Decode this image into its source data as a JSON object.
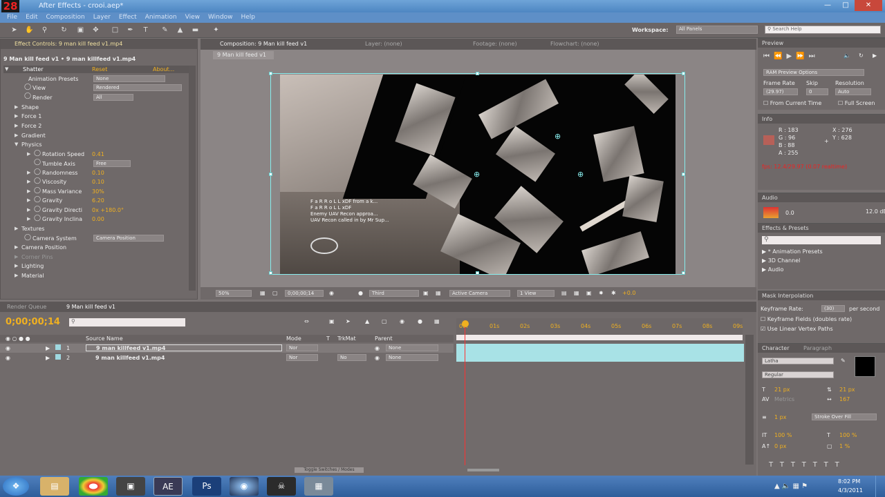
{
  "app": {
    "badge": "28",
    "title": "After Effects - crooi.aep*"
  },
  "menu": [
    "File",
    "Edit",
    "Composition",
    "Layer",
    "Effect",
    "Animation",
    "View",
    "Window",
    "Help"
  ],
  "workspace": {
    "label": "Workspace:",
    "value": "All Panels",
    "search_placeholder": "Search Help"
  },
  "effect_controls": {
    "tab": "Effect Controls: 9 man kill feed v1.mp4",
    "layer": "9 Man kill feed v1 • 9 man killfeed v1.mp4",
    "effect": "Shatter",
    "reset": "Reset",
    "about": "About...",
    "props": [
      {
        "label": "Animation Presets",
        "value": "None"
      },
      {
        "label": "View",
        "value": "Rendered"
      },
      {
        "label": "Render",
        "value": "All"
      },
      {
        "label": "Shape"
      },
      {
        "label": "Force 1"
      },
      {
        "label": "Force 2"
      },
      {
        "label": "Gradient"
      },
      {
        "label": "Physics"
      },
      {
        "label": "Rotation Speed",
        "value": "0.41"
      },
      {
        "label": "Tumble Axis",
        "value": "Free"
      },
      {
        "label": "Randomness",
        "value": "0.10"
      },
      {
        "label": "Viscosity",
        "value": "0.10"
      },
      {
        "label": "Mass Variance",
        "value": "30%"
      },
      {
        "label": "Gravity",
        "value": "6.20"
      },
      {
        "label": "Gravity Directi",
        "value": "0x +180.0°"
      },
      {
        "label": "Gravity Inclina",
        "value": "0.00"
      },
      {
        "label": "Textures"
      },
      {
        "label": "Camera System",
        "value": "Camera Position"
      },
      {
        "label": "Camera Position"
      },
      {
        "label": "Corner Pins"
      },
      {
        "label": "Lighting"
      },
      {
        "label": "Material"
      }
    ]
  },
  "viewer": {
    "tabs": [
      "Composition: 9 Man kill feed v1",
      "Layer: (none)",
      "Footage: (none)",
      "Flowchart: (none)"
    ],
    "comp_tab": "9 Man kill feed v1",
    "zoom": "50%",
    "time": "0;00;00;14",
    "resolution": "Third",
    "camera": "Active Camera",
    "views": "1 View",
    "exposure": "+0.0",
    "overlay": [
      "F a R R o L L xDF from a k...",
      "F a R R o L L xDF",
      "Enemy UAV Recon approa...",
      "UAV Recon called in by Mr Sup..."
    ]
  },
  "timeline": {
    "tabs": [
      "Render Queue",
      "9 Man kill feed v1"
    ],
    "time": "0;00;00;14",
    "headers": [
      "Source Name",
      "Mode",
      "T",
      "TrkMat",
      "Parent"
    ],
    "layers": [
      {
        "num": "1",
        "name": "9 man killfeed v1.mp4",
        "mode": "Nor",
        "trk": "",
        "parent": "None"
      },
      {
        "num": "2",
        "name": "9 man killfeed v1.mp4",
        "mode": "Nor",
        "trk": "No",
        "parent": "None"
      }
    ],
    "ruler": [
      "00f",
      "01s",
      "02s",
      "03s",
      "04s",
      "05s",
      "06s",
      "07s",
      "08s",
      "09s"
    ],
    "toggle": "Toggle Switches / Modes"
  },
  "preview": {
    "title": "Preview",
    "options": "RAM Preview Options",
    "frame_rate_label": "Frame Rate",
    "frame_rate": "(29.97)",
    "skip_label": "Skip",
    "skip": "0",
    "res_label": "Resolution",
    "res": "Auto",
    "from_current": "From Current Time",
    "full_screen": "Full Screen"
  },
  "info": {
    "title": "Info",
    "r": "R : 183",
    "g": "G : 96",
    "b": "B : 88",
    "a": "A : 255",
    "x": "X : 276",
    "y": "Y : 628",
    "fps": "fps: 12.4/29.97 (0.07 realtime)"
  },
  "audio": {
    "title": "Audio",
    "l": "0.0",
    "r": "12.0 dB"
  },
  "effects_presets": {
    "title": "Effects & Presets",
    "items": [
      "* Animation Presets",
      "3D Channel",
      "Audio"
    ]
  },
  "mask": {
    "title": "Mask Interpolation",
    "rate_label": "Keyframe Rate:",
    "rate": "(30)",
    "per": "per second",
    "fields": "Keyframe Fields (doubles rate)",
    "linear": "Use Linear Vertex Paths"
  },
  "character": {
    "tabs": [
      "Character",
      "Paragraph"
    ],
    "font": "Latha",
    "style": "Regular",
    "size": "21 px",
    "leading": "21 px",
    "kerning": "Metrics",
    "tracking": "167",
    "stroke": "1 px",
    "stroke_mode": "Stroke Over Fill",
    "vscale": "100 %",
    "hscale": "100 %",
    "baseline": "0 px",
    "tsume": "1 %"
  },
  "tray": {
    "time": "8:02 PM",
    "date": "4/3/2011"
  },
  "colors": {
    "accent": "#f0b020",
    "selection": "#8ee8e8",
    "playhead": "#ff3030"
  }
}
